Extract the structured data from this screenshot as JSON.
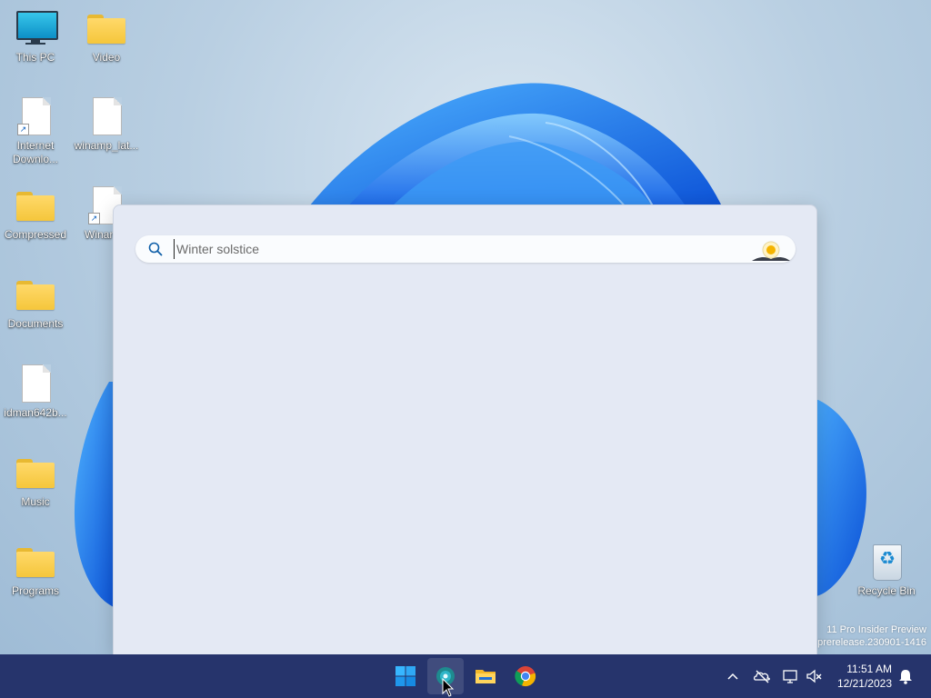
{
  "desktop": {
    "icons": [
      {
        "label": "This PC",
        "icon": "this-pc-icon"
      },
      {
        "label": "Video",
        "icon": "folder-icon"
      },
      {
        "label": "Internet Downlo...",
        "icon": "document-shortcut-icon"
      },
      {
        "label": "winamp_lat...",
        "icon": "document-icon"
      },
      {
        "label": "Compressed",
        "icon": "folder-icon"
      },
      {
        "label": "Winar",
        "icon": "document-shortcut-icon"
      },
      {
        "label": "Documents",
        "icon": "folder-icon"
      },
      {
        "label": "idman642b...",
        "icon": "document-icon"
      },
      {
        "label": "Music",
        "icon": "folder-icon"
      },
      {
        "label": "Programs",
        "icon": "folder-icon"
      },
      {
        "label": "Recycle Bin",
        "icon": "recycle-bin-icon"
      }
    ],
    "watermark": {
      "line1": "11 Pro Insider Preview",
      "line2": "prerelease.230901-1416"
    }
  },
  "search": {
    "placeholder": "Winter solstice",
    "value": "",
    "highlight_icon": "winter-solstice-sun-icon"
  },
  "taskbar": {
    "apps": [
      {
        "name": "start-button",
        "icon": "windows-logo-icon"
      },
      {
        "name": "search-button",
        "icon": "search-highlight-icon",
        "active": true
      },
      {
        "name": "file-explorer-button",
        "icon": "file-explorer-icon"
      },
      {
        "name": "chrome-button",
        "icon": "chrome-icon"
      }
    ],
    "tray": {
      "icons": [
        "chevron-up-icon",
        "onedrive-offline-icon",
        "network-icon",
        "volume-muted-icon"
      ],
      "time": "11:51 AM",
      "date": "12/21/2023",
      "notification_icon": "bell-icon"
    }
  },
  "colors": {
    "taskbar": "#26346c",
    "panel": "#e4e9f4",
    "bloom": "#1a6fe0"
  }
}
